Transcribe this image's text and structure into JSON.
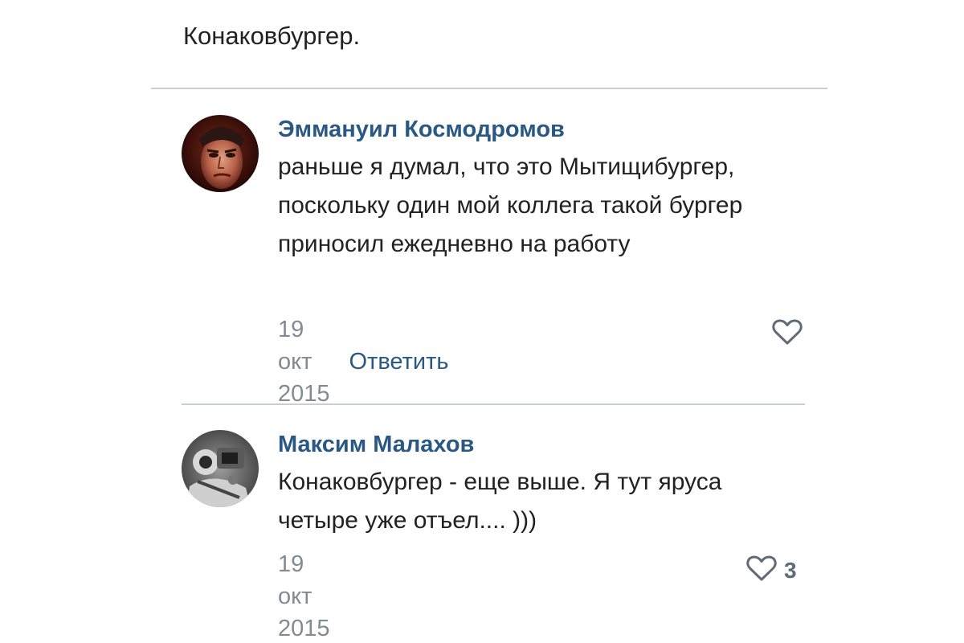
{
  "previous_comment": {
    "text": "Конаковбургер."
  },
  "comments": [
    {
      "author": "Эммануил Космодромов",
      "text": "раньше я думал, что это Мытищибургер, поскольку один мой коллега такой бургер приносил ежедневно на работу",
      "date": "19 окт 2015",
      "reply_label": "Ответить",
      "likes": null,
      "like_icon": "heart-outline-icon"
    },
    {
      "author": "Максим Малахов",
      "text": "Конаковбургер - еще выше. Я тут яруса четыре уже отъел.... )))",
      "date": "19 окт 2015",
      "likes": "3",
      "like_icon": "heart-outline-icon"
    }
  ],
  "colors": {
    "author_link": "#2a5885",
    "meta_gray": "#828a94",
    "divider": "#c9ced6",
    "like_icon": "#5f6b78"
  }
}
